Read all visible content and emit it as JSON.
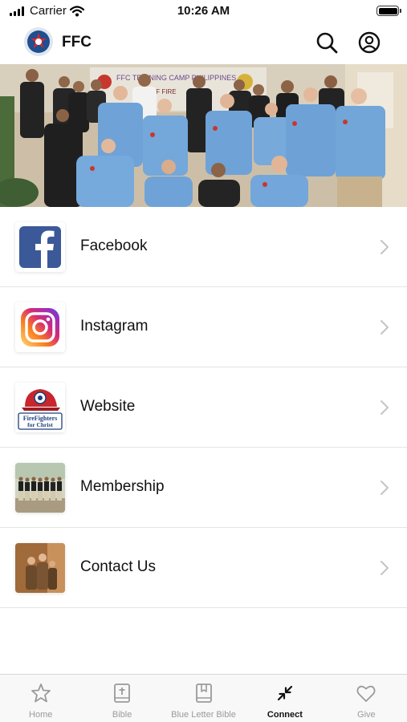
{
  "status_bar": {
    "carrier": "Carrier",
    "time": "10:26 AM"
  },
  "header": {
    "title": "FFC"
  },
  "hero": {
    "banner_text": "FFC TRAINING CAMP PHILIPPINES",
    "banner_text_2": "OF FIRE"
  },
  "menu": [
    {
      "label": "Facebook"
    },
    {
      "label": "Instagram"
    },
    {
      "label": "Website",
      "logo_text_1": "FireFighters",
      "logo_text_2": "for Christ"
    },
    {
      "label": "Membership"
    },
    {
      "label": "Contact Us"
    }
  ],
  "tabs": [
    {
      "label": "Home",
      "icon": "star-icon"
    },
    {
      "label": "Bible",
      "icon": "bible-icon"
    },
    {
      "label": "Blue Letter Bible",
      "icon": "bookmark-book-icon"
    },
    {
      "label": "Connect",
      "icon": "connect-arrows-icon",
      "active": true
    },
    {
      "label": "Give",
      "icon": "heart-icon"
    }
  ],
  "colors": {
    "accent": "#1877f2",
    "uniform_blue": "#6fa3d8",
    "dark_uniform": "#232323"
  }
}
